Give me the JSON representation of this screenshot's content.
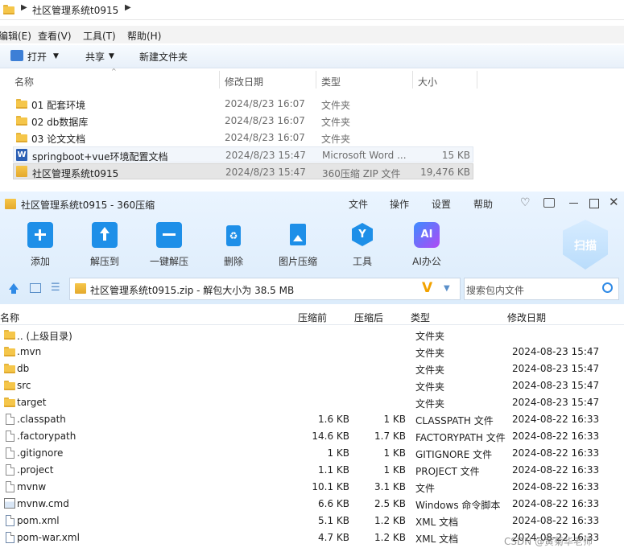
{
  "explorer": {
    "breadcrumb": [
      "社区管理系统t0915"
    ],
    "menu": [
      "编辑(E)",
      "查看(V)",
      "工具(T)",
      "帮助(H)"
    ],
    "toolbar": {
      "open": "打开",
      "share": "共享",
      "new_folder": "新建文件夹"
    },
    "columns": {
      "name": "名称",
      "date": "修改日期",
      "type": "类型",
      "size": "大小"
    },
    "rows": [
      {
        "name": "01 配套环境",
        "date": "2024/8/23 16:07",
        "type": "文件夹",
        "size": "",
        "icon": "folder-icon"
      },
      {
        "name": "02 db数据库",
        "date": "2024/8/23 16:07",
        "type": "文件夹",
        "size": "",
        "icon": "folder-icon"
      },
      {
        "name": "03 论文文档",
        "date": "2024/8/23 16:07",
        "type": "文件夹",
        "size": "",
        "icon": "folder-icon"
      },
      {
        "name": "springboot+vue环境配置文档",
        "date": "2024/8/23 15:47",
        "type": "Microsoft Word ...",
        "size": "15 KB",
        "icon": "word-icon"
      },
      {
        "name": "社区管理系统t0915",
        "date": "2024/8/23 15:47",
        "type": "360压缩 ZIP 文件",
        "size": "19,476 KB",
        "icon": "zip-icon"
      }
    ]
  },
  "zip": {
    "title": "社区管理系统t0915 - 360压缩",
    "menu": [
      "文件",
      "操作",
      "设置",
      "帮助"
    ],
    "tools": [
      "添加",
      "解压到",
      "一键解压",
      "删除",
      "图片压缩",
      "工具",
      "AI办公"
    ],
    "scan": "扫描",
    "address": "社区管理系统t0915.zip - 解包大小为 38.5 MB",
    "search_placeholder": "搜索包内文件",
    "columns": {
      "name": "名称",
      "packed": "压缩前",
      "unpacked": "压缩后",
      "type": "类型",
      "date": "修改日期"
    },
    "rows": [
      {
        "name": ".. (上级目录)",
        "packed": "",
        "unpacked": "",
        "type": "文件夹",
        "date": "",
        "icon": "folder-icon"
      },
      {
        "name": ".mvn",
        "packed": "",
        "unpacked": "",
        "type": "文件夹",
        "date": "2024-08-23 15:47",
        "icon": "folder-icon"
      },
      {
        "name": "db",
        "packed": "",
        "unpacked": "",
        "type": "文件夹",
        "date": "2024-08-23 15:47",
        "icon": "folder-icon"
      },
      {
        "name": "src",
        "packed": "",
        "unpacked": "",
        "type": "文件夹",
        "date": "2024-08-23 15:47",
        "icon": "folder-icon"
      },
      {
        "name": "target",
        "packed": "",
        "unpacked": "",
        "type": "文件夹",
        "date": "2024-08-23 15:47",
        "icon": "folder-icon"
      },
      {
        "name": ".classpath",
        "packed": "1.6 KB",
        "unpacked": "1 KB",
        "type": "CLASSPATH 文件",
        "date": "2024-08-22 16:33",
        "icon": "file-icon"
      },
      {
        "name": ".factorypath",
        "packed": "14.6 KB",
        "unpacked": "1.7 KB",
        "type": "FACTORYPATH 文件",
        "date": "2024-08-22 16:33",
        "icon": "file-icon"
      },
      {
        "name": ".gitignore",
        "packed": "1 KB",
        "unpacked": "1 KB",
        "type": "GITIGNORE 文件",
        "date": "2024-08-22 16:33",
        "icon": "file-icon"
      },
      {
        "name": ".project",
        "packed": "1.1 KB",
        "unpacked": "1 KB",
        "type": "PROJECT 文件",
        "date": "2024-08-22 16:33",
        "icon": "file-icon"
      },
      {
        "name": "mvnw",
        "packed": "10.1 KB",
        "unpacked": "3.1 KB",
        "type": "文件",
        "date": "2024-08-22 16:33",
        "icon": "file-icon"
      },
      {
        "name": "mvnw.cmd",
        "packed": "6.6 KB",
        "unpacked": "2.5 KB",
        "type": "Windows 命令脚本",
        "date": "2024-08-22 16:33",
        "icon": "cmd-icon"
      },
      {
        "name": "pom.xml",
        "packed": "5.1 KB",
        "unpacked": "1.2 KB",
        "type": "XML 文档",
        "date": "2024-08-22 16:33",
        "icon": "xml-icon"
      },
      {
        "name": "pom-war.xml",
        "packed": "4.7 KB",
        "unpacked": "1.2 KB",
        "type": "XML 文档",
        "date": "2024-08-22 16:33",
        "icon": "xml-icon"
      }
    ]
  },
  "watermark": "CSDN @黄菊华老师"
}
